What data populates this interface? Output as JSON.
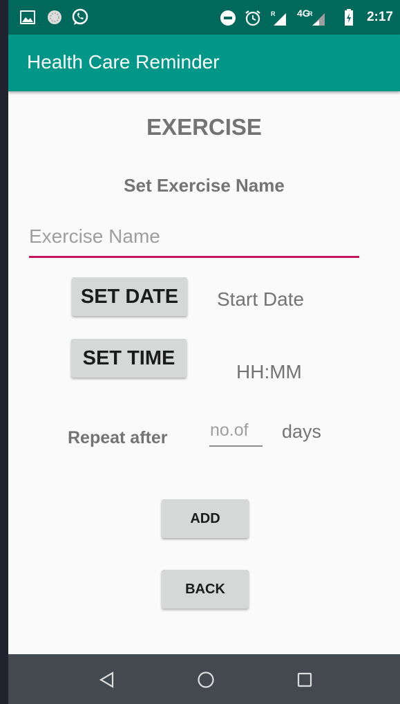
{
  "status_bar": {
    "time": "2:17",
    "network": "4G",
    "icons": [
      "image-icon",
      "sync-icon",
      "whatsapp-icon",
      "dnd-icon",
      "alarm-icon",
      "signal-icon",
      "signal-roaming-icon",
      "battery-charging-icon"
    ]
  },
  "app_bar": {
    "title": "Health Care Reminder",
    "color": "#009688"
  },
  "form": {
    "title": "EXERCISE",
    "subtitle": "Set Exercise Name",
    "name_placeholder": "Exercise Name",
    "name_value": "",
    "set_date_label": "SET DATE",
    "start_date_text": "Start Date",
    "set_time_label": "SET TIME",
    "time_text": "HH:MM",
    "repeat_label": "Repeat after",
    "repeat_placeholder": "no.of",
    "repeat_value": "",
    "days_label": "days",
    "add_label": "ADD",
    "back_label": "BACK",
    "accent_color": "#c2185b"
  },
  "nav_bar": {
    "buttons": [
      "back-icon",
      "home-icon",
      "recents-icon"
    ]
  }
}
